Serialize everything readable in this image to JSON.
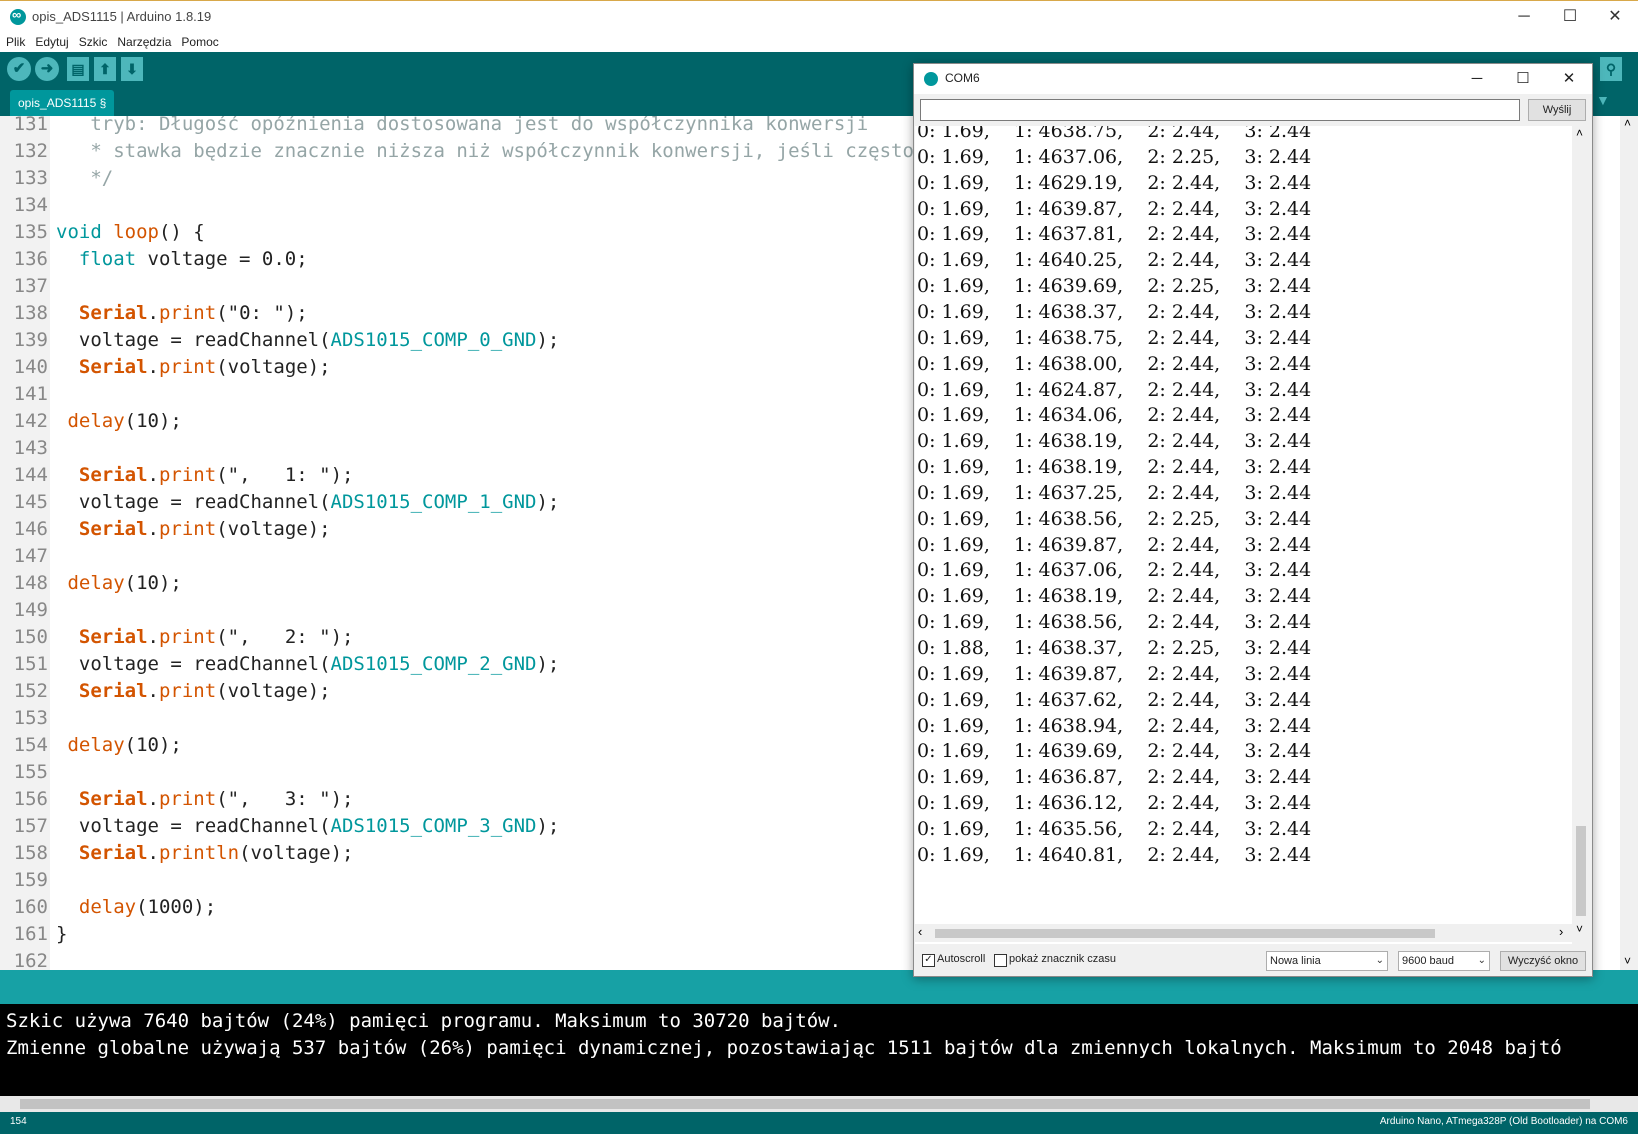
{
  "window": {
    "title": "opis_ADS1115 | Arduino 1.8.19"
  },
  "menu": [
    "Plik",
    "Edytuj",
    "Szkic",
    "Narzędzia",
    "Pomoc"
  ],
  "tab": {
    "label": "opis_ADS1115 §"
  },
  "editor_lines": [
    {
      "n": "131",
      "segs": [
        [
          "k-cmt",
          "   tryb: Długość opóźnienia dostosowana jest do współczynnika konwersji"
        ]
      ]
    },
    {
      "n": "132",
      "segs": [
        [
          "k-cmt",
          "   * stawka będzie znacznie niższa niż współczynnik konwersji, jeśli częstotliwość"
        ]
      ]
    },
    {
      "n": "133",
      "segs": [
        [
          "k-cmt",
          "   */"
        ]
      ]
    },
    {
      "n": "134",
      "segs": []
    },
    {
      "n": "135",
      "segs": [
        [
          "k-type",
          "void"
        ],
        [
          "",
          " "
        ],
        [
          "k-fn",
          "loop"
        ],
        [
          "",
          "() {"
        ]
      ]
    },
    {
      "n": "136",
      "segs": [
        [
          "",
          "  "
        ],
        [
          "k-type",
          "float"
        ],
        [
          "",
          " voltage = 0.0;"
        ]
      ]
    },
    {
      "n": "137",
      "segs": []
    },
    {
      "n": "138",
      "segs": [
        [
          "",
          "  "
        ],
        [
          "k-obj",
          "Serial"
        ],
        [
          "",
          "."
        ],
        [
          "k-fn",
          "print"
        ],
        [
          "",
          "(\"0: \");"
        ]
      ]
    },
    {
      "n": "139",
      "segs": [
        [
          "",
          "  voltage = readChannel("
        ],
        [
          "k-const",
          "ADS1015_COMP_0_GND"
        ],
        [
          "",
          ");"
        ]
      ]
    },
    {
      "n": "140",
      "segs": [
        [
          "",
          "  "
        ],
        [
          "k-obj",
          "Serial"
        ],
        [
          "",
          "."
        ],
        [
          "k-fn",
          "print"
        ],
        [
          "",
          "(voltage);"
        ]
      ]
    },
    {
      "n": "141",
      "segs": []
    },
    {
      "n": "142",
      "segs": [
        [
          "",
          " "
        ],
        [
          "k-fn",
          "delay"
        ],
        [
          "",
          "(10);"
        ]
      ]
    },
    {
      "n": "143",
      "segs": []
    },
    {
      "n": "144",
      "segs": [
        [
          "",
          "  "
        ],
        [
          "k-obj",
          "Serial"
        ],
        [
          "",
          "."
        ],
        [
          "k-fn",
          "print"
        ],
        [
          "",
          "(\",   1: \");"
        ]
      ]
    },
    {
      "n": "145",
      "segs": [
        [
          "",
          "  voltage = readChannel("
        ],
        [
          "k-const",
          "ADS1015_COMP_1_GND"
        ],
        [
          "",
          ");"
        ]
      ]
    },
    {
      "n": "146",
      "segs": [
        [
          "",
          "  "
        ],
        [
          "k-obj",
          "Serial"
        ],
        [
          "",
          "."
        ],
        [
          "k-fn",
          "print"
        ],
        [
          "",
          "(voltage);"
        ]
      ]
    },
    {
      "n": "147",
      "segs": []
    },
    {
      "n": "148",
      "segs": [
        [
          "",
          " "
        ],
        [
          "k-fn",
          "delay"
        ],
        [
          "",
          "(10);"
        ]
      ]
    },
    {
      "n": "149",
      "segs": []
    },
    {
      "n": "150",
      "segs": [
        [
          "",
          "  "
        ],
        [
          "k-obj",
          "Serial"
        ],
        [
          "",
          "."
        ],
        [
          "k-fn",
          "print"
        ],
        [
          "",
          "(\",   2: \");"
        ]
      ]
    },
    {
      "n": "151",
      "segs": [
        [
          "",
          "  voltage = readChannel("
        ],
        [
          "k-const",
          "ADS1015_COMP_2_GND"
        ],
        [
          "",
          ");"
        ]
      ]
    },
    {
      "n": "152",
      "segs": [
        [
          "",
          "  "
        ],
        [
          "k-obj",
          "Serial"
        ],
        [
          "",
          "."
        ],
        [
          "k-fn",
          "print"
        ],
        [
          "",
          "(voltage);"
        ]
      ]
    },
    {
      "n": "153",
      "segs": []
    },
    {
      "n": "154",
      "segs": [
        [
          "",
          " "
        ],
        [
          "k-fn",
          "delay"
        ],
        [
          "",
          "(10);"
        ]
      ]
    },
    {
      "n": "155",
      "segs": []
    },
    {
      "n": "156",
      "segs": [
        [
          "",
          "  "
        ],
        [
          "k-obj",
          "Serial"
        ],
        [
          "",
          "."
        ],
        [
          "k-fn",
          "print"
        ],
        [
          "",
          "(\",   3: \");"
        ]
      ]
    },
    {
      "n": "157",
      "segs": [
        [
          "",
          "  voltage = readChannel("
        ],
        [
          "k-const",
          "ADS1015_COMP_3_GND"
        ],
        [
          "",
          ");"
        ]
      ]
    },
    {
      "n": "158",
      "segs": [
        [
          "",
          "  "
        ],
        [
          "k-obj",
          "Serial"
        ],
        [
          "",
          "."
        ],
        [
          "k-fn",
          "println"
        ],
        [
          "",
          "(voltage);"
        ]
      ]
    },
    {
      "n": "159",
      "segs": []
    },
    {
      "n": "160",
      "segs": [
        [
          "",
          "  "
        ],
        [
          "k-fn",
          "delay"
        ],
        [
          "",
          "(1000);"
        ]
      ]
    },
    {
      "n": "161",
      "segs": [
        [
          "",
          "}"
        ]
      ]
    },
    {
      "n": "162",
      "segs": []
    }
  ],
  "console": [
    "Szkic używa 7640 bajtów (24%) pamięci programu. Maksimum to 30720 bajtów.",
    "Zmienne globalne używają 537 bajtów (26%) pamięci dynamicznej, pozostawiając 1511 bajtów dla zmiennych lokalnych. Maksimum to 2048 bajtó"
  ],
  "statusbar": {
    "line": "154",
    "board": "Arduino Nano, ATmega328P (Old Bootloader) na COM6"
  },
  "serial_monitor": {
    "title": "COM6",
    "input_value": "",
    "send_label": "Wyślij",
    "autoscroll_label": "Autoscroll",
    "autoscroll_checked": "true",
    "timestamp_label": "pokaż znacznik czasu",
    "line_ending": "Nowa linia",
    "baud": "9600 baud",
    "clear_label": "Wyczyść okno",
    "output": [
      "0: 1.69,    1: 4638.75,    2: 2.44,    3: 2.44",
      "0: 1.69,    1: 4637.06,    2: 2.25,    3: 2.44",
      "0: 1.69,    1: 4629.19,    2: 2.44,    3: 2.44",
      "0: 1.69,    1: 4639.87,    2: 2.44,    3: 2.44",
      "0: 1.69,    1: 4637.81,    2: 2.44,    3: 2.44",
      "0: 1.69,    1: 4640.25,    2: 2.44,    3: 2.44",
      "0: 1.69,    1: 4639.69,    2: 2.25,    3: 2.44",
      "0: 1.69,    1: 4638.37,    2: 2.44,    3: 2.44",
      "0: 1.69,    1: 4638.75,    2: 2.44,    3: 2.44",
      "0: 1.69,    1: 4638.00,    2: 2.44,    3: 2.44",
      "0: 1.69,    1: 4624.87,    2: 2.44,    3: 2.44",
      "0: 1.69,    1: 4634.06,    2: 2.44,    3: 2.44",
      "0: 1.69,    1: 4638.19,    2: 2.44,    3: 2.44",
      "0: 1.69,    1: 4638.19,    2: 2.44,    3: 2.44",
      "0: 1.69,    1: 4637.25,    2: 2.44,    3: 2.44",
      "0: 1.69,    1: 4638.56,    2: 2.25,    3: 2.44",
      "0: 1.69,    1: 4639.87,    2: 2.44,    3: 2.44",
      "0: 1.69,    1: 4637.06,    2: 2.44,    3: 2.44",
      "0: 1.69,    1: 4638.19,    2: 2.44,    3: 2.44",
      "0: 1.69,    1: 4638.56,    2: 2.44,    3: 2.44",
      "0: 1.88,    1: 4638.37,    2: 2.25,    3: 2.44",
      "0: 1.69,    1: 4639.87,    2: 2.44,    3: 2.44",
      "0: 1.69,    1: 4637.62,    2: 2.44,    3: 2.44",
      "0: 1.69,    1: 4638.94,    2: 2.44,    3: 2.44",
      "0: 1.69,    1: 4639.69,    2: 2.44,    3: 2.44",
      "0: 1.69,    1: 4636.87,    2: 2.44,    3: 2.44",
      "0: 1.69,    1: 4636.12,    2: 2.44,    3: 2.44",
      "0: 1.69,    1: 4635.56,    2: 2.44,    3: 2.44",
      "0: 1.69,    1: 4640.81,    2: 2.44,    3: 2.44"
    ]
  },
  "icons": {
    "verify": "✔",
    "upload": "➜",
    "new": "▤",
    "open": "⬆",
    "save": "⬇",
    "serial_monitor": "⚲",
    "tab_menu": "▼",
    "minimize": "─",
    "maximize": "☐",
    "close": "✕",
    "scroll_up": "˄",
    "scroll_down": "˅",
    "scroll_left": "‹",
    "scroll_right": "›",
    "dropdown": "⌄"
  },
  "colors": {
    "teal_dark": "#006468",
    "teal": "#00979c",
    "keyword_orange": "#d35400"
  }
}
